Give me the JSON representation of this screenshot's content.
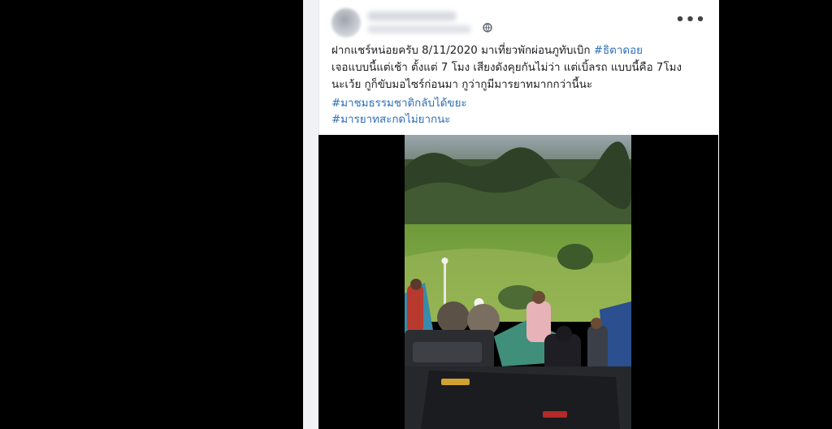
{
  "post": {
    "text_line1_prefix": "ฝากแชร์หน่อยครับ 8/11/2020 มาเที่ยวพักผ่อนภูทับเบิก ",
    "text_line1_tag": "#ธิตาดอย",
    "text_line2": "เจอแบบนี้แต่เช้า ตั้งแต่ 7 โมง เสียงดังคุยกันไม่ว่า แต่เบิ้ลรถ แบบนี้คือ 7โมง",
    "text_line3": "นะเว้ย กูก็ขับมอไซร์ก่อนมา กูว่ากูมีมารยาทมากกว่านี้นะ",
    "hashtags": [
      "#มาชมธรรมชาติกลับได้ขยะ",
      "#มารยาทสะกดไม่ยากนะ"
    ]
  },
  "header": {
    "more_label": "•••",
    "globe_icon": "globe-icon"
  },
  "colors": {
    "background": "#000000",
    "card": "#ffffff",
    "hashtag": "#2f6fb7",
    "text": "#1c1e21"
  }
}
